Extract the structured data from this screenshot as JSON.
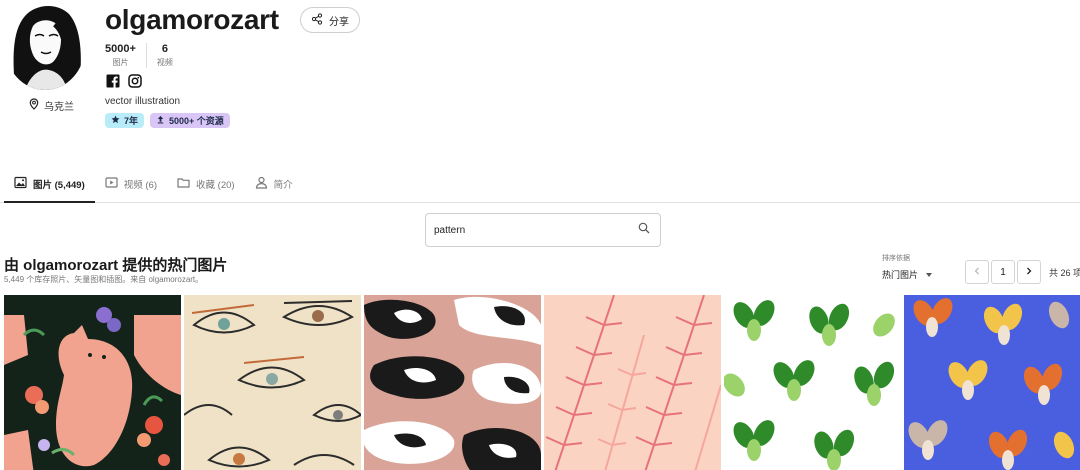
{
  "profile": {
    "username": "olgamorozart",
    "share_label": "分享",
    "location": "乌克兰",
    "bio": "vector illustration",
    "stats": [
      {
        "value": "5000+",
        "label": "图片"
      },
      {
        "value": "6",
        "label": "视频"
      }
    ],
    "socials": [
      "facebook-icon",
      "instagram-icon"
    ],
    "badges": [
      {
        "label": "7年",
        "icon": "star-icon",
        "color": "#b9ecf9"
      },
      {
        "label": "5000+ 个资源",
        "icon": "upload-icon",
        "color": "#d9c6f6"
      }
    ]
  },
  "tabs": [
    {
      "label": "图片 (5,449)",
      "icon": "image-icon",
      "active": true
    },
    {
      "label": "视频 (6)",
      "icon": "video-icon",
      "active": false
    },
    {
      "label": "收藏 (20)",
      "icon": "folder-icon",
      "active": false
    },
    {
      "label": "简介",
      "icon": "person-icon",
      "active": false
    }
  ],
  "search": {
    "value": "pattern"
  },
  "section": {
    "title": "由 olgamorozart 提供的热门图片",
    "subtitle": "5,449 个库存照片、矢量图和插图。来自 olgamorozart。"
  },
  "sort": {
    "label": "排序依据",
    "value": "热门图片"
  },
  "pagination": {
    "current": "1",
    "total_text": "共 26 项"
  },
  "images": [
    {
      "subject": "pink cat with flowers pattern",
      "colors": [
        "#13231a",
        "#f2a38f"
      ]
    },
    {
      "subject": "eyes pattern",
      "colors": [
        "#efe2c6",
        "#2c2c2c"
      ]
    },
    {
      "subject": "black and white cats pattern",
      "colors": [
        "#d9a497",
        "#1a1a1a"
      ]
    },
    {
      "subject": "pink palm leaves pattern",
      "colors": [
        "#fbd3c3",
        "#e6737a"
      ]
    },
    {
      "subject": "green leaves pattern",
      "colors": [
        "#ffffff",
        "#2f8a2a"
      ]
    },
    {
      "subject": "autumn leaves on blue pattern",
      "colors": [
        "#4a5fe0",
        "#e3702e"
      ]
    }
  ]
}
